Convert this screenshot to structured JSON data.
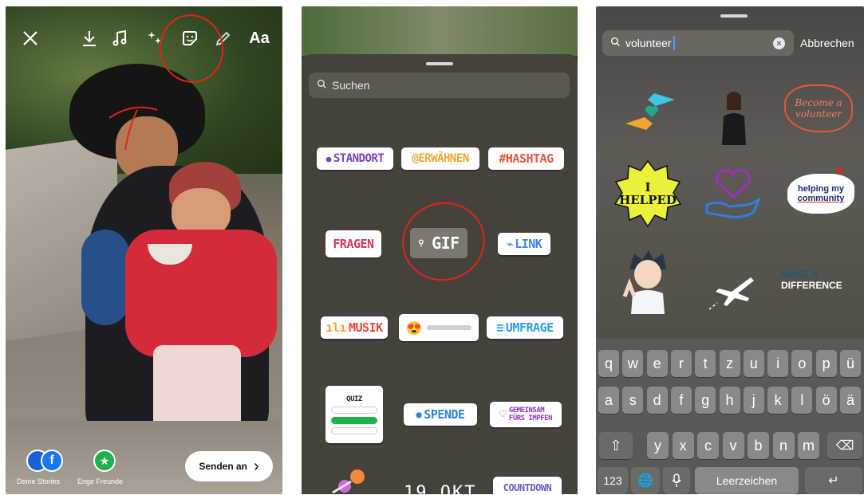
{
  "editor": {
    "text_tool_label": "Aa",
    "stories_label": "Deine Stories",
    "close_friends_label": "Enge Freunde",
    "send_label": "Senden an",
    "send_arrow": "›",
    "icons": [
      "close-icon",
      "download-icon",
      "music-icon",
      "effects-icon",
      "sticker-icon",
      "draw-icon"
    ],
    "annotation_color": "#e2231a"
  },
  "stickers": {
    "search_placeholder": "Suchen",
    "items": [
      {
        "label": "STANDORT",
        "color": "#7b3fc8"
      },
      {
        "label": "@ERWÄHNEN",
        "color": "#f2a531"
      },
      {
        "label": "#HASHTAG",
        "color": "#e8553f"
      },
      {
        "label": "FRAGEN",
        "color": "#d8345f"
      },
      {
        "label": "GIF",
        "color": "#ffffff"
      },
      {
        "label": "LINK",
        "color": "#3b83f6"
      },
      {
        "label": "MUSIK",
        "color": "#e8483f"
      },
      {
        "label": "UMFRAGE",
        "color": "#2ba1e0"
      },
      {
        "label": "QUIZ",
        "color": "#222222"
      },
      {
        "label": "SPENDE",
        "color": "#2f7fe0"
      },
      {
        "label": "GEMEINSAM",
        "color": "#9b2fc4"
      },
      {
        "label": "FÜRS IMPFEN",
        "color": "#9b2fc4"
      },
      {
        "label": "COUNTDOWN",
        "color": "#6a5acd"
      },
      {
        "label": "19 OKT",
        "color": "#ffffff"
      }
    ]
  },
  "giphy": {
    "query": "volunteer",
    "cancel_label": "Abbrechen",
    "results": {
      "become": "Become a volunteer",
      "helped_1": "I",
      "helped_2": "HELPED",
      "community_1": "helping my",
      "community_2": "community",
      "make": "MAKE A",
      "difference": "DIFFERENCE"
    }
  },
  "keyboard": {
    "row1": [
      "q",
      "w",
      "e",
      "r",
      "t",
      "z",
      "u",
      "i",
      "o",
      "p",
      "ü"
    ],
    "row2": [
      "a",
      "s",
      "d",
      "f",
      "g",
      "h",
      "j",
      "k",
      "l",
      "ö",
      "ä"
    ],
    "row3": [
      "y",
      "x",
      "c",
      "v",
      "b",
      "n",
      "m"
    ],
    "numbers_label": "123",
    "space_label": "Leerzeichen"
  }
}
